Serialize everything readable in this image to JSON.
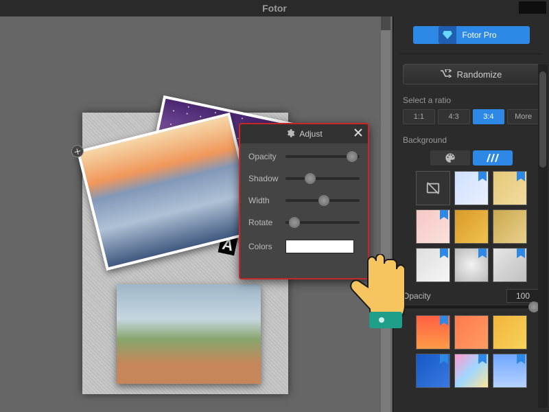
{
  "app": {
    "title": "Fotor"
  },
  "pro_button": "Fotor Pro",
  "randomize_button": "Randomize",
  "ratio": {
    "label": "Select a ratio",
    "options": [
      "1:1",
      "4:3",
      "3:4",
      "More"
    ],
    "selected": "3:4"
  },
  "background": {
    "label": "Background",
    "tabs": [
      "palette",
      "pattern"
    ],
    "active_tab": "pattern"
  },
  "opacity": {
    "label": "Opacity",
    "value": "100",
    "pct": 100
  },
  "adjust": {
    "title": "Adjust",
    "items": [
      {
        "label": "Opacity",
        "value": 90
      },
      {
        "label": "Shadow",
        "value": 33
      },
      {
        "label": "Width",
        "value": 52
      },
      {
        "label": "Rotate",
        "value": 12
      }
    ],
    "colors_label": "Colors",
    "color": "#ffffff"
  },
  "swatches_top": [
    {
      "type": "none"
    },
    {
      "bg": "linear-gradient(135deg,#cfe0ff,#eaf1ff)",
      "pro": true
    },
    {
      "bg": "linear-gradient(135deg,#e6c878,#f1dca0)",
      "pro": true
    },
    {
      "bg": "linear-gradient(135deg,#f7c7c5,#f9e2db)",
      "pro": true
    },
    {
      "bg": "linear-gradient(135deg,#d89a28,#f1c24f)"
    },
    {
      "bg": "linear-gradient(135deg,#caa84f,#e9d18c)"
    },
    {
      "bg": "linear-gradient(135deg,#dedede,#f6f6f6)",
      "pro": true
    },
    {
      "bg": "radial-gradient(circle,#f3f3f3,#b9b9b9)",
      "pro": true
    },
    {
      "bg": "linear-gradient(135deg,#e6e6e6,#c0c0c0)",
      "pro": true
    }
  ],
  "swatches_bottom": [
    {
      "bg": "linear-gradient(180deg,#ff5f43,#ff9b47)",
      "pro": true
    },
    {
      "bg": "linear-gradient(135deg,#ff7a4e,#ff9d63)"
    },
    {
      "bg": "linear-gradient(135deg,#f3b53a,#f7d25b)"
    },
    {
      "bg": "linear-gradient(135deg,#1559c7,#3a79e0)",
      "pro": true
    },
    {
      "bg": "linear-gradient(135deg,#ff9bcf,#9fd7ff 50%,#ffe598)",
      "pro": true
    },
    {
      "bg": "linear-gradient(180deg,#6ea6ff,#b7d3ff)",
      "pro": true
    }
  ],
  "band_text": "A"
}
